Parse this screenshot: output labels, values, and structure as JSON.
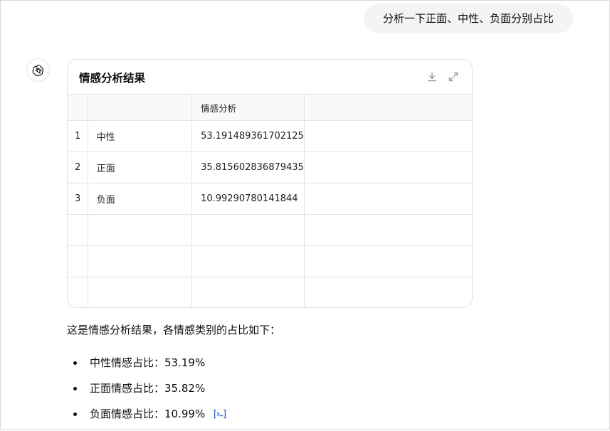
{
  "user_message": "分析一下正面、中性、负面分别占比",
  "card": {
    "title": "情感分析结果",
    "column_headers": [
      "",
      "",
      "情感分析",
      ""
    ],
    "rows": [
      {
        "index": "1",
        "label": "中性",
        "value": "53.191489361702125"
      },
      {
        "index": "2",
        "label": "正面",
        "value": "35.815602836879435"
      },
      {
        "index": "3",
        "label": "负面",
        "value": "10.99290780141844"
      }
    ]
  },
  "summary": "这是情感分析结果，各情感类别的占比如下：",
  "bullets": [
    {
      "text": "中性情感占比：53.19%"
    },
    {
      "text": "正面情感占比：35.82%"
    },
    {
      "text": "负面情感占比：10.99%"
    }
  ],
  "colors": {
    "user_bubble": "#f4f4f4",
    "border": "#e3e3e3",
    "header_bg": "#f9f9f9",
    "icon_gray": "#9b9b9b",
    "citation_blue": "#3b6fd4"
  }
}
